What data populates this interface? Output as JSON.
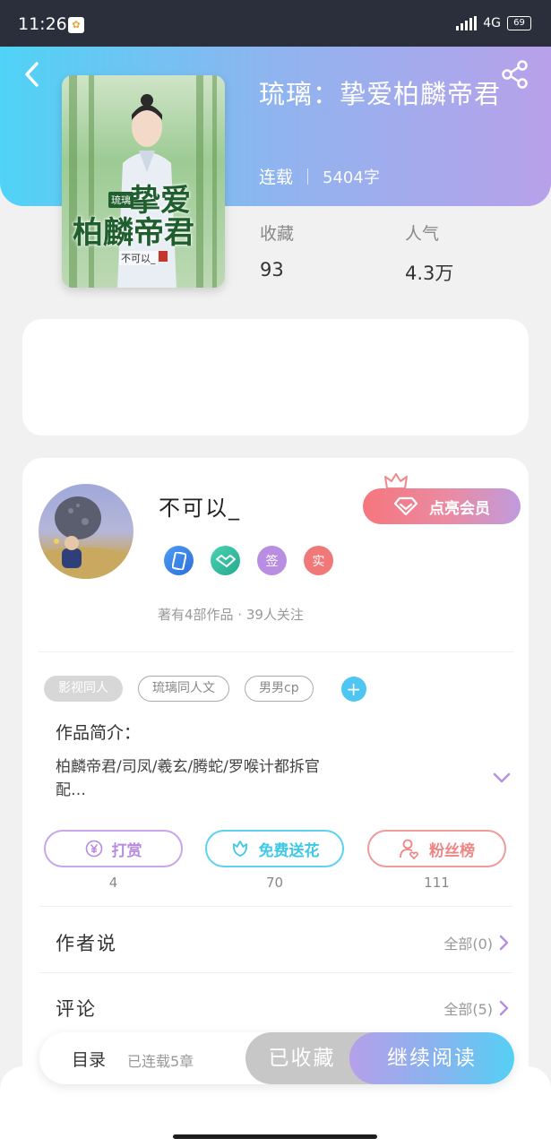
{
  "status_bar": {
    "time": "11:26",
    "network": "4G",
    "battery": "69"
  },
  "book": {
    "title": "琉璃：挚爱柏麟帝君",
    "status": "连载",
    "word_count": "5404字",
    "cover": {
      "tag": "琉璃",
      "title_line1": "挚爱",
      "title_line2": "柏麟帝君",
      "author": "不可以_"
    }
  },
  "stats": {
    "favorites_label": "收藏",
    "favorites_value": "93",
    "popularity_label": "人气",
    "popularity_value": "4.3万"
  },
  "author": {
    "name": "不可以_",
    "vip_label": "点亮会员",
    "badges": [
      "签",
      "实"
    ],
    "summary": "著有4部作品 · 39人关注"
  },
  "tags": [
    "影视同人",
    "琉璃同人文",
    "男男cp"
  ],
  "intro": {
    "label": "作品简介：",
    "text": "柏麟帝君/司凤/羲玄/腾蛇/罗喉计都拆官配…"
  },
  "actions": [
    {
      "label": "打赏",
      "count": "4",
      "color": "#b78be0"
    },
    {
      "label": "免费送花",
      "count": "70",
      "color": "#3ec9e8"
    },
    {
      "label": "粉丝榜",
      "count": "111",
      "color": "#ef8686"
    }
  ],
  "sections": {
    "author_says": {
      "title": "作者说",
      "more": "全部(0)"
    },
    "comments": {
      "title": "评论",
      "more": "全部(5)"
    }
  },
  "bottom_bar": {
    "toc_label": "目录",
    "toc_sub": "已连载5章",
    "favorited_label": "已收藏",
    "continue_label": "继续阅读"
  },
  "colors": {
    "accent_start": "#4fd3f6",
    "accent_end": "#b8a1ea",
    "vip_start": "#f5767d"
  }
}
